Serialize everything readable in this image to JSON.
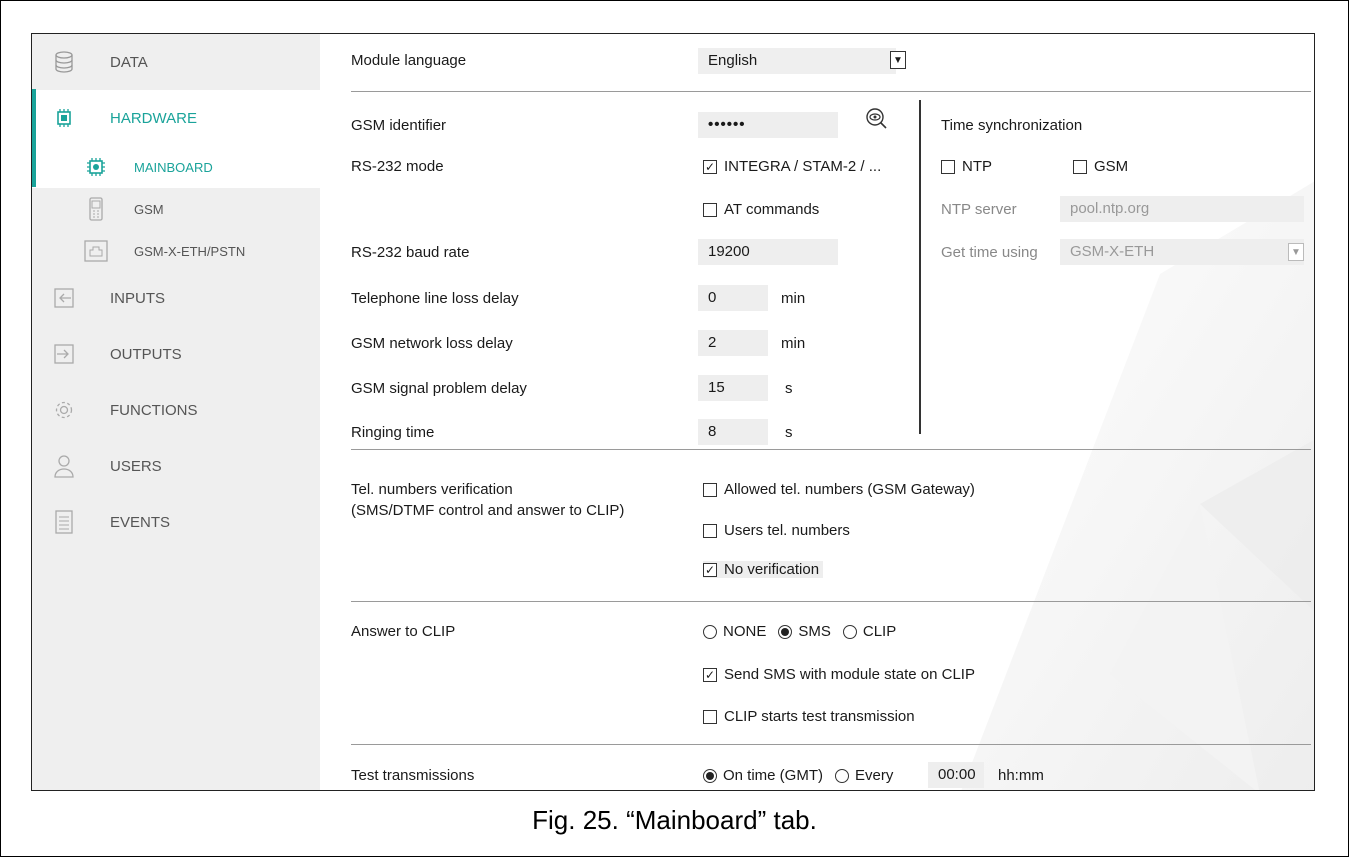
{
  "sidebar": {
    "items": [
      {
        "label": "DATA",
        "icon": "database-icon"
      },
      {
        "label": "HARDWARE",
        "icon": "chip-icon"
      },
      {
        "label": "MAINBOARD",
        "icon": "mainboard-icon"
      },
      {
        "label": "GSM",
        "icon": "phone-icon"
      },
      {
        "label": "GSM-X-ETH/PSTN",
        "icon": "ethernet-icon"
      },
      {
        "label": "INPUTS",
        "icon": "input-icon"
      },
      {
        "label": "OUTPUTS",
        "icon": "output-icon"
      },
      {
        "label": "FUNCTIONS",
        "icon": "gear-icon"
      },
      {
        "label": "USERS",
        "icon": "user-icon"
      },
      {
        "label": "EVENTS",
        "icon": "document-icon"
      }
    ],
    "accent": "#1aa39a"
  },
  "main": {
    "module_language_label": "Module language",
    "module_language_value": "English",
    "gsm_identifier_label": "GSM identifier",
    "gsm_identifier_value": "••••••",
    "rs232_mode_label": "RS-232 mode",
    "rs232_opt1": "INTEGRA / STAM-2 / ...",
    "rs232_opt2": "AT commands",
    "baud_label": "RS-232 baud rate",
    "baud_value": "19200",
    "tel_loss_label": "Telephone line loss delay",
    "tel_loss_value": "0",
    "gsm_loss_label": "GSM network loss delay",
    "gsm_loss_value": "2",
    "signal_label": "GSM signal problem delay",
    "signal_value": "15",
    "ringing_label": "Ringing time",
    "ringing_value": "8",
    "unit_min": "min",
    "unit_s": "s",
    "time_sync_label": "Time synchronization",
    "ntp_label": "NTP",
    "gsm_label": "GSM",
    "ntp_server_label": "NTP server",
    "ntp_server_value": "pool.ntp.org",
    "get_time_label": "Get time using",
    "get_time_value": "GSM-X-ETH",
    "verify_label_1": "Tel. numbers verification",
    "verify_label_2": "(SMS/DTMF control and answer to CLIP)",
    "verify_opt1": "Allowed tel. numbers (GSM Gateway)",
    "verify_opt2": "Users tel. numbers",
    "verify_opt3": "No verification",
    "clip_label": "Answer to CLIP",
    "clip_none": "NONE",
    "clip_sms": "SMS",
    "clip_clip": "CLIP",
    "clip_send_sms": "Send SMS with module state on CLIP",
    "clip_test": "CLIP starts test transmission",
    "test_label": "Test transmissions",
    "test_opt1": "On time (GMT)",
    "test_opt2": "Every",
    "test_time": "00:00",
    "test_unit": "hh:mm"
  },
  "caption": "Fig. 25. “Mainboard” tab."
}
